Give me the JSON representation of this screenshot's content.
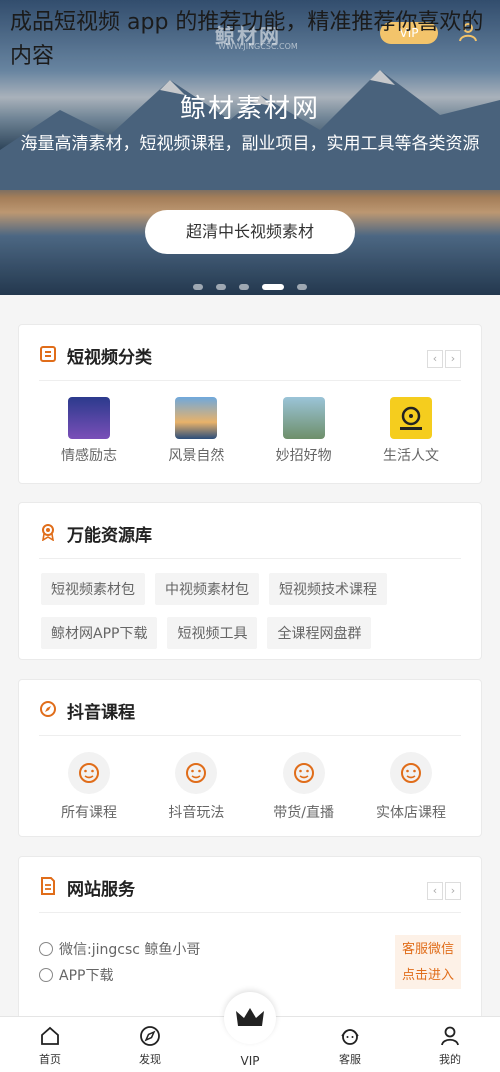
{
  "caption": "成品短视频 app 的推荐功能，精准推荐你喜欢的内容",
  "header": {
    "logo": "鲸材网",
    "logo_sub": "WWW.JINGCSC.COM",
    "vip": "VIP"
  },
  "banner": {
    "title": "鲸材素材网",
    "subtitle": "海量高清素材，短视频课程，副业项目，实用工具等各类资源",
    "button": "超清中长视频素材",
    "dots": 5,
    "active_dot": 4
  },
  "categories": {
    "title": "短视频分类",
    "prev": "‹",
    "next": "›",
    "items": [
      {
        "label": "情感励志",
        "icon": "emotion-thumb"
      },
      {
        "label": "风景自然",
        "icon": "landscape-thumb"
      },
      {
        "label": "妙招好物",
        "icon": "tips-thumb"
      },
      {
        "label": "生活人文",
        "icon": "life-thumb"
      }
    ]
  },
  "library": {
    "title": "万能资源库",
    "tags": [
      "短视频素材包",
      "中视频素材包",
      "短视频技术课程",
      "鲸材网APP下载",
      "短视频工具",
      "全课程网盘群"
    ]
  },
  "courses": {
    "title": "抖音课程",
    "items": [
      {
        "label": "所有课程"
      },
      {
        "label": "抖音玩法"
      },
      {
        "label": "带货/直播"
      },
      {
        "label": "实体店课程"
      }
    ]
  },
  "services": {
    "title": "网站服务",
    "prev": "‹",
    "next": "›",
    "lines": [
      "微信:jingcsc 鲸鱼小哥",
      "APP下载"
    ],
    "contact_button": [
      "客服微信",
      "点击进入"
    ]
  },
  "nav": [
    {
      "label": "首页",
      "icon": "home-icon"
    },
    {
      "label": "发现",
      "icon": "compass-icon"
    },
    {
      "label": "VIP",
      "icon": "crown-icon"
    },
    {
      "label": "客服",
      "icon": "service-icon"
    },
    {
      "label": "我的",
      "icon": "user-icon"
    }
  ],
  "colors": {
    "accent": "#e06d1a",
    "vip_gold": "#f3c46b"
  }
}
